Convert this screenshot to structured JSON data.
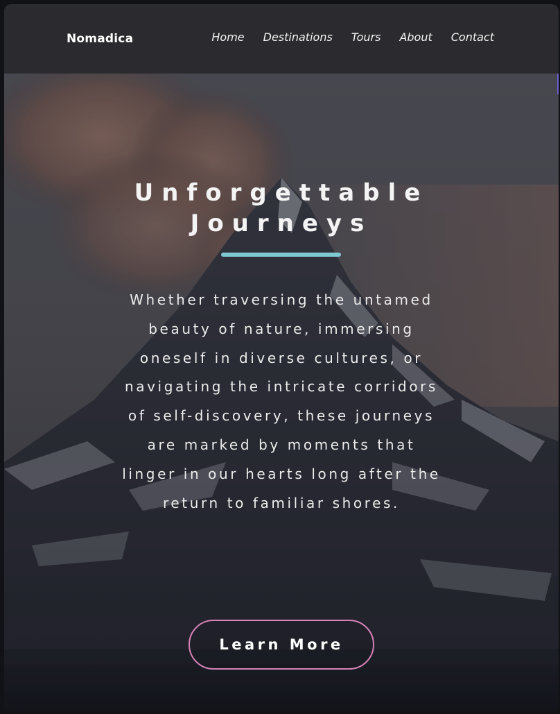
{
  "brand": {
    "name": "Nomadica"
  },
  "nav": {
    "items": [
      {
        "label": "Home"
      },
      {
        "label": "Destinations"
      },
      {
        "label": "Tours"
      },
      {
        "label": "About"
      },
      {
        "label": "Contact"
      }
    ]
  },
  "hero": {
    "title_line1": "Unforgettable",
    "title_line2": "Journeys",
    "body": "Whether traversing the untamed beauty of nature, immersing oneself in diverse cultures, or navigating the intricate corridors of self-discovery, these journeys are marked by moments that linger in our hearts long after the return to familiar shores.",
    "cta_label": "Learn More",
    "background_image": "mountain-peak-with-clouds"
  },
  "colors": {
    "navbar": "#2b2b2f",
    "accent_underline": "#7fc8cf",
    "cta_border": "#d782b8",
    "text": "#f4f4f4"
  }
}
